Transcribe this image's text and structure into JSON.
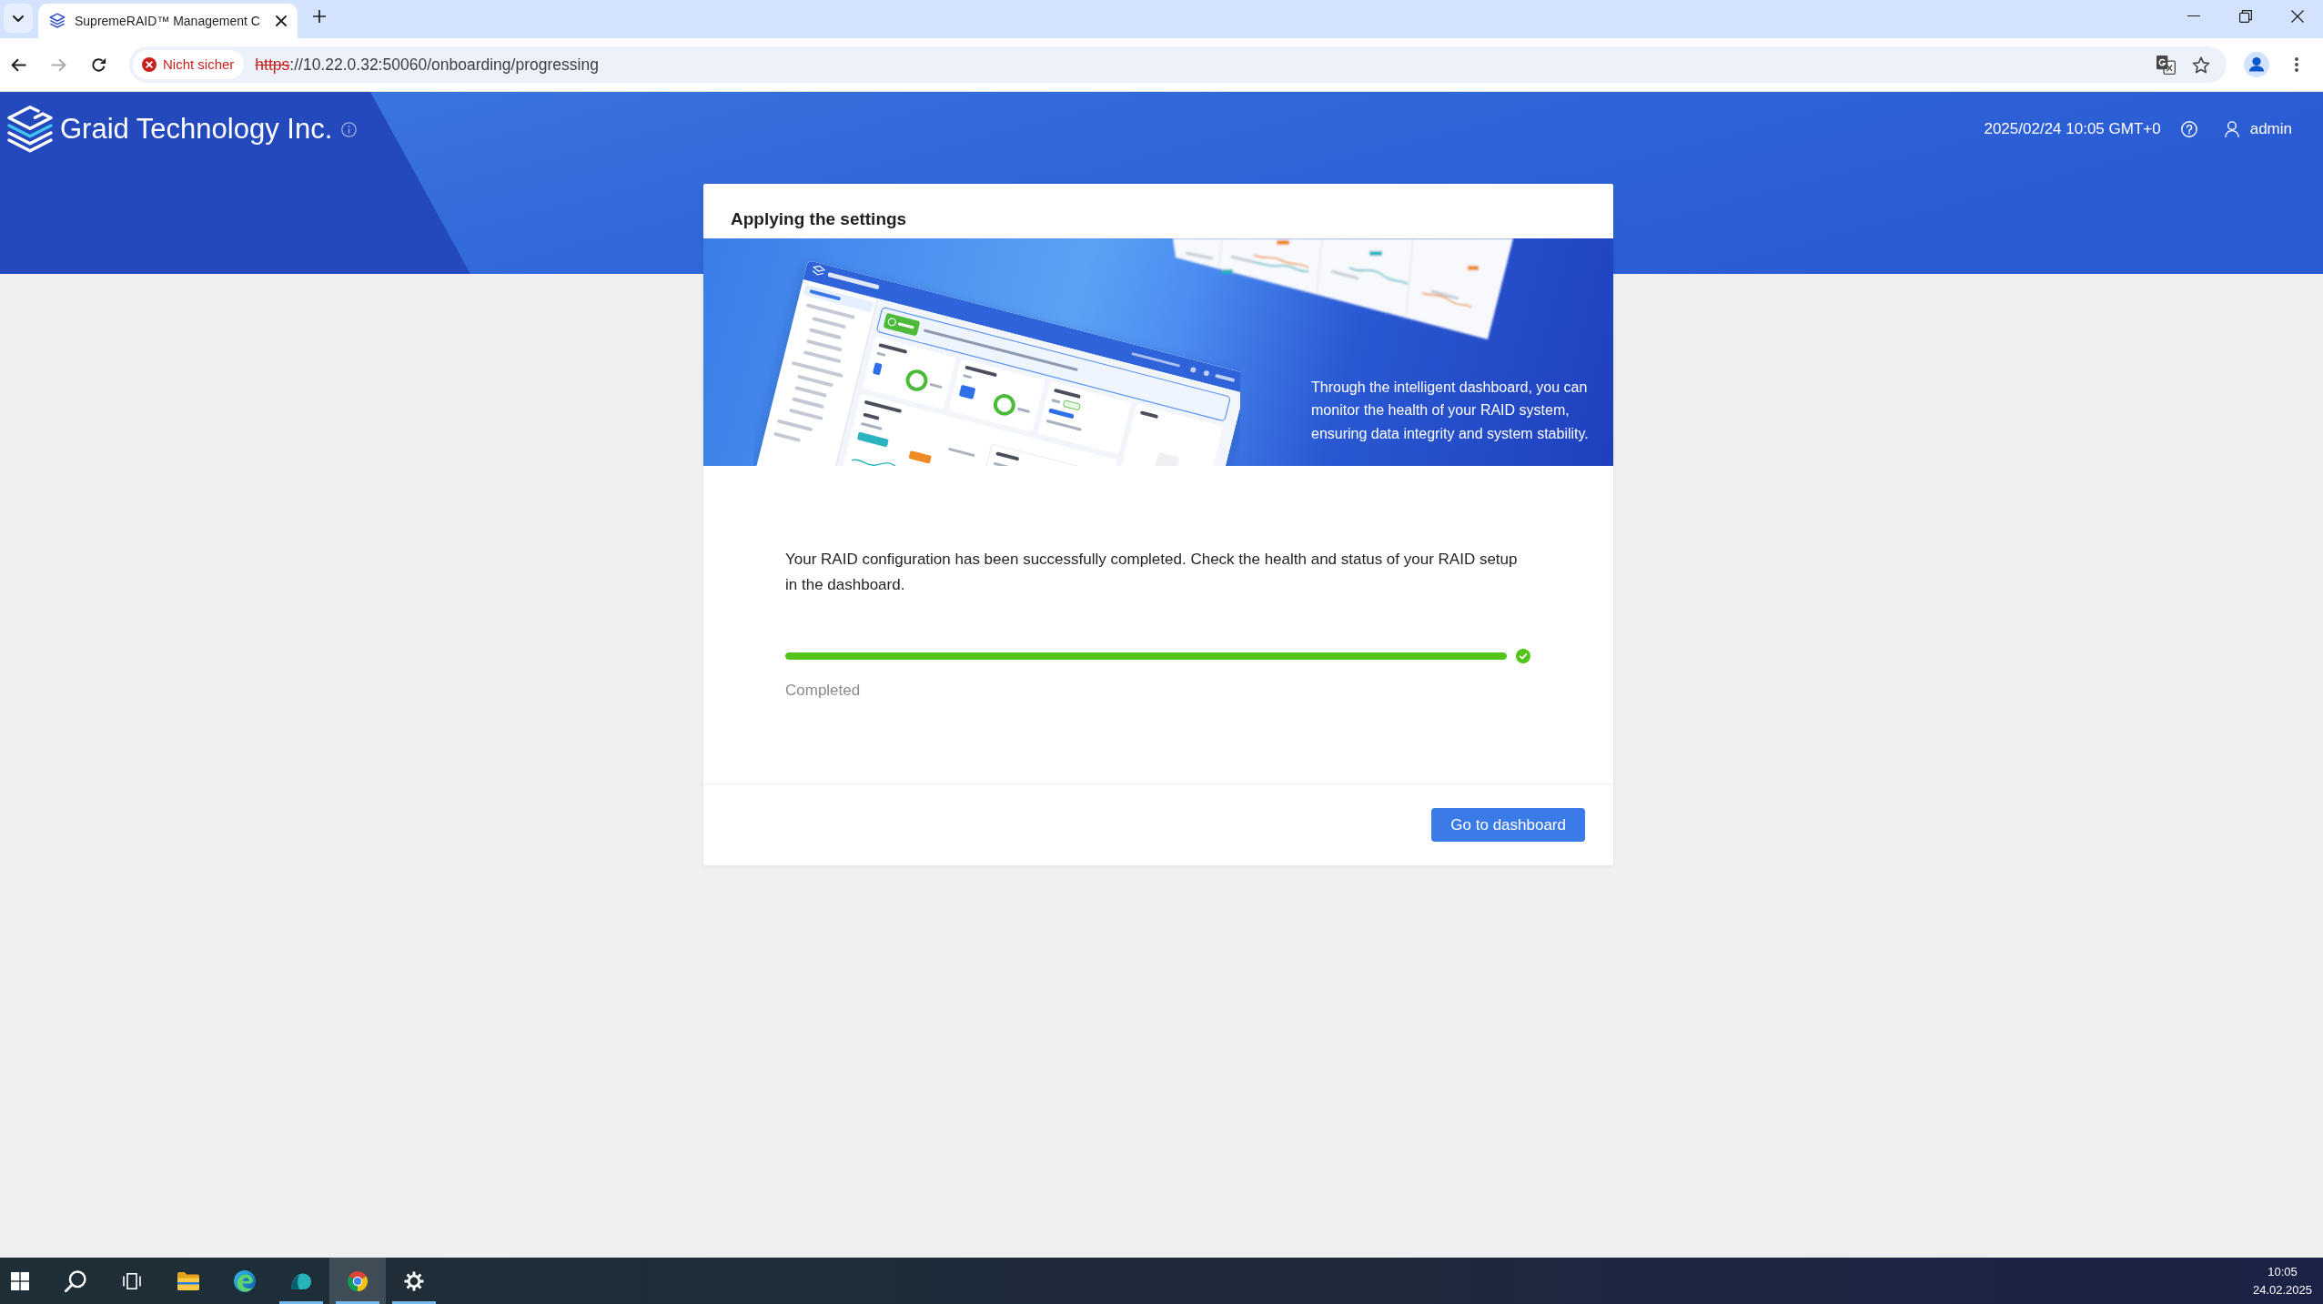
{
  "browser": {
    "tabs": [
      {
        "title": "SupremeRAID™ Management C",
        "selected": true
      }
    ],
    "back": {
      "disabled": false
    },
    "forward": {
      "disabled": true
    },
    "security_chip": "Nicht sicher",
    "url": {
      "scheme": "https",
      "rest": "://10.22.0.32:50060/onboarding/progressing"
    }
  },
  "header": {
    "brand": "Graid Technology Inc.",
    "datetime": "2025/02/24 10:05 GMT+0",
    "user": "admin"
  },
  "card": {
    "title": "Applying the settings",
    "banner_caption": "Through the intelligent dashboard, you can monitor the health of your RAID system, ensuring data integrity and system stability.",
    "message": "Your RAID configuration has been successfully completed. Check the health and status of your RAID setup in the dashboard.",
    "progress": {
      "level": 1,
      "complete": true,
      "status": "Completed"
    },
    "button": "Go to dashboard"
  },
  "taskbar": {
    "apps": [
      {
        "running": false,
        "selected": false
      },
      {
        "running": false,
        "selected": false
      },
      {
        "running": true,
        "selected": false
      },
      {
        "running": true,
        "selected": true
      },
      {
        "running": true,
        "selected": false
      }
    ],
    "time": "10:05",
    "date": "24.02.2025"
  }
}
